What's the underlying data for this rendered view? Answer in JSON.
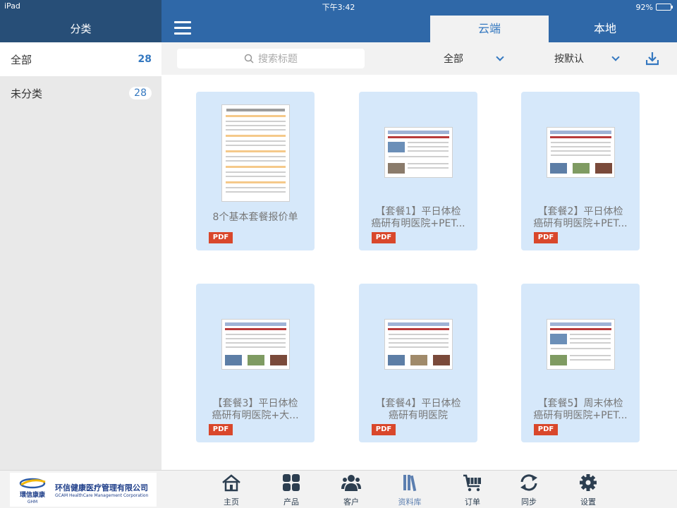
{
  "status_bar": {
    "device": "iPad",
    "time": "下午3:42",
    "battery": "92%",
    "battery_fraction": 0.92
  },
  "sidebar": {
    "title": "分类",
    "items": [
      {
        "label": "全部",
        "count": "28"
      },
      {
        "label": "未分类",
        "count": "28"
      }
    ]
  },
  "tabs": {
    "cloud": "云端",
    "local": "本地"
  },
  "toolbar": {
    "search_placeholder": "搜索标题",
    "filter_value": "全部",
    "sort_value": "按默认"
  },
  "documents": [
    {
      "title_lines": [
        "8个基本套餐报价单"
      ],
      "type": "PDF"
    },
    {
      "title_lines": [
        "【套餐1】平日体检",
        "癌研有明医院+PET..."
      ],
      "type": "PDF"
    },
    {
      "title_lines": [
        "【套餐2】平日体检",
        "癌研有明医院+PET..."
      ],
      "type": "PDF"
    },
    {
      "title_lines": [
        "【套餐3】平日体检",
        "癌研有明医院+大..."
      ],
      "type": "PDF"
    },
    {
      "title_lines": [
        "【套餐4】平日体检",
        "癌研有明医院"
      ],
      "type": "PDF"
    },
    {
      "title_lines": [
        "【套餐5】周末体检",
        "癌研有明医院+PET..."
      ],
      "type": "PDF"
    }
  ],
  "logo": {
    "cn_mark": "環信康康",
    "en_mark": "GHM",
    "company_cn": "环信健康医疗管理有限公司",
    "company_en": "GCAM HealthCare Management Corporation"
  },
  "bottom_nav": [
    {
      "label": "主页",
      "icon": "home-icon"
    },
    {
      "label": "产品",
      "icon": "grid-icon"
    },
    {
      "label": "客户",
      "icon": "users-icon"
    },
    {
      "label": "资料库",
      "icon": "library-icon",
      "active": true
    },
    {
      "label": "订单",
      "icon": "cart-icon"
    },
    {
      "label": "同步",
      "icon": "sync-icon"
    },
    {
      "label": "设置",
      "icon": "gear-icon"
    }
  ],
  "colors": {
    "header_dark": "#274e77",
    "header_blue": "#2f68a8",
    "accent": "#3478c0",
    "card_bg": "#d6e8fa",
    "pdf_badge": "#d9472b"
  }
}
